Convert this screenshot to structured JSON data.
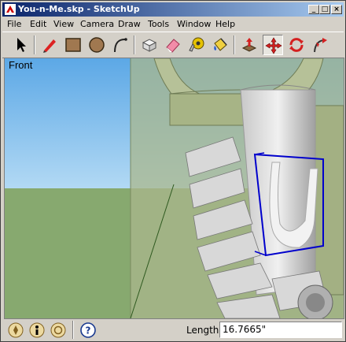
{
  "window": {
    "title": "You-n-Me.skp - SketchUp",
    "minimize": "_",
    "maximize": "□",
    "close": "×"
  },
  "menu": [
    "File",
    "Edit",
    "View",
    "Camera",
    "Draw",
    "Tools",
    "Window",
    "Help"
  ],
  "toolbar": {
    "tools": [
      {
        "name": "select",
        "icon": "arrow-cursor-icon"
      },
      {
        "name": "line",
        "icon": "pencil-icon"
      },
      {
        "name": "rectangle",
        "icon": "rectangle-icon"
      },
      {
        "name": "circle",
        "icon": "circle-icon"
      },
      {
        "name": "arc",
        "icon": "arc-icon"
      },
      {
        "name": "make-component",
        "icon": "component-icon"
      },
      {
        "name": "eraser",
        "icon": "eraser-icon"
      },
      {
        "name": "tape-measure",
        "icon": "tape-measure-icon"
      },
      {
        "name": "paint-bucket",
        "icon": "paint-bucket-icon"
      },
      {
        "name": "push-pull",
        "icon": "push-pull-icon"
      },
      {
        "name": "move",
        "icon": "move-icon"
      },
      {
        "name": "rotate",
        "icon": "rotate-icon"
      },
      {
        "name": "follow-me",
        "icon": "follow-me-icon"
      }
    ],
    "active_tool": "move"
  },
  "viewport": {
    "scene_label": "Front",
    "sky_color": "#8ec8f0",
    "ground_color": "#8fb27a",
    "model_color": "#a9b78c",
    "selection_color": "#0000cc"
  },
  "statusbar": {
    "measurement_label": "Length",
    "measurement_value": "16.7665\"",
    "icons": [
      "geo-location-icon",
      "credits-icon",
      "user-icon",
      "help-icon"
    ]
  }
}
